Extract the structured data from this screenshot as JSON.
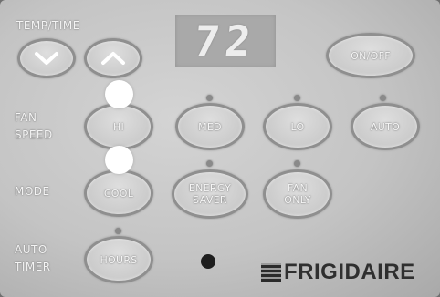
{
  "labels": {
    "temp_time": "TEMP/TIME",
    "fan_speed": "FAN\nSPEED",
    "mode": "MODE",
    "auto_timer": "AUTO\nTIMER"
  },
  "display": {
    "value": "72"
  },
  "buttons": {
    "down": "down-arrow",
    "up": "up-arrow",
    "on_off": "ON/OFF",
    "fan_hi": "HI",
    "fan_med": "MED",
    "fan_lo": "LO",
    "fan_auto": "AUTO",
    "mode_cool": "COOL",
    "mode_energy_saver": "ENERGY\nSAVER",
    "mode_fan_only": "FAN\nONLY",
    "timer_hours": "HOURS"
  },
  "brand": {
    "name": "FRIGIDAIRE"
  },
  "colors": {
    "panel": "#c9c9c9",
    "button_ring": "#8f8f8f",
    "label_text": "#f4f4f4",
    "brand_text": "#2f2f2f",
    "sensor": "#1e1e1e",
    "marker": "#ffffff"
  }
}
